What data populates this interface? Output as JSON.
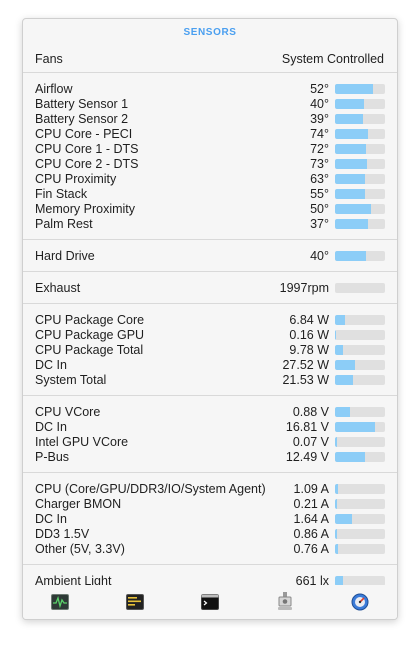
{
  "header": {
    "title": "SENSORS"
  },
  "fans": {
    "label": "Fans",
    "value": "System Controlled"
  },
  "sections": [
    {
      "name": "temperatures",
      "rows": [
        {
          "label": "Airflow",
          "value": "52°",
          "level": 0.76
        },
        {
          "label": "Battery Sensor 1",
          "value": "40°",
          "level": 0.58
        },
        {
          "label": "Battery Sensor 2",
          "value": "39°",
          "level": 0.56
        },
        {
          "label": "CPU Core - PECI",
          "value": "74°",
          "level": 0.66
        },
        {
          "label": "CPU Core 1 - DTS",
          "value": "72°",
          "level": 0.62
        },
        {
          "label": "CPU Core 2 - DTS",
          "value": "73°",
          "level": 0.64
        },
        {
          "label": "CPU Proximity",
          "value": "63°",
          "level": 0.6
        },
        {
          "label": "Fin Stack",
          "value": "55°",
          "level": 0.6
        },
        {
          "label": "Memory Proximity",
          "value": "50°",
          "level": 0.72
        },
        {
          "label": "Palm Rest",
          "value": "37°",
          "level": 0.66
        }
      ]
    },
    {
      "name": "drives",
      "rows": [
        {
          "label": "Hard Drive",
          "value": "40°",
          "level": 0.62
        }
      ]
    },
    {
      "name": "exhaust",
      "rows": [
        {
          "label": "Exhaust",
          "value": "1997rpm",
          "level": 0
        }
      ]
    },
    {
      "name": "power",
      "rows": [
        {
          "label": "CPU Package Core",
          "value": "6.84 W",
          "level": 0.2
        },
        {
          "label": "CPU Package GPU",
          "value": "0.16 W",
          "level": 0.02
        },
        {
          "label": "CPU Package Total",
          "value": "9.78 W",
          "level": 0.16
        },
        {
          "label": "DC In",
          "value": "27.52 W",
          "level": 0.4
        },
        {
          "label": "System Total",
          "value": "21.53 W",
          "level": 0.36
        }
      ]
    },
    {
      "name": "voltage",
      "rows": [
        {
          "label": "CPU VCore",
          "value": "0.88 V",
          "level": 0.3
        },
        {
          "label": "DC In",
          "value": "16.81 V",
          "level": 0.8
        },
        {
          "label": "Intel GPU VCore",
          "value": "0.07 V",
          "level": 0.04
        },
        {
          "label": "P-Bus",
          "value": "12.49 V",
          "level": 0.6
        }
      ]
    },
    {
      "name": "current",
      "rows": [
        {
          "label": "CPU (Core/GPU/DDR3/IO/System Agent)",
          "value": "1.09 A",
          "level": 0.06
        },
        {
          "label": "Charger BMON",
          "value": "0.21 A",
          "level": 0.04
        },
        {
          "label": "DC In",
          "value": "1.64 A",
          "level": 0.34
        },
        {
          "label": "DD3 1.5V",
          "value": "0.86 A",
          "level": 0.04
        },
        {
          "label": "Other (5V, 3.3V)",
          "value": "0.76 A",
          "level": 0.06
        }
      ]
    },
    {
      "name": "light",
      "rows": [
        {
          "label": "Ambient Light",
          "value": "661 lx",
          "level": 0.16
        }
      ]
    }
  ],
  "toolbar": {
    "items": [
      {
        "name": "activity-monitor-icon"
      },
      {
        "name": "console-icon"
      },
      {
        "name": "terminal-icon"
      },
      {
        "name": "system-info-icon"
      },
      {
        "name": "disk-utility-icon"
      }
    ]
  },
  "colors": {
    "accent": "#4a9ff0",
    "bar_fill": "#8ccdf7",
    "bar_track": "#e0e0e0"
  }
}
